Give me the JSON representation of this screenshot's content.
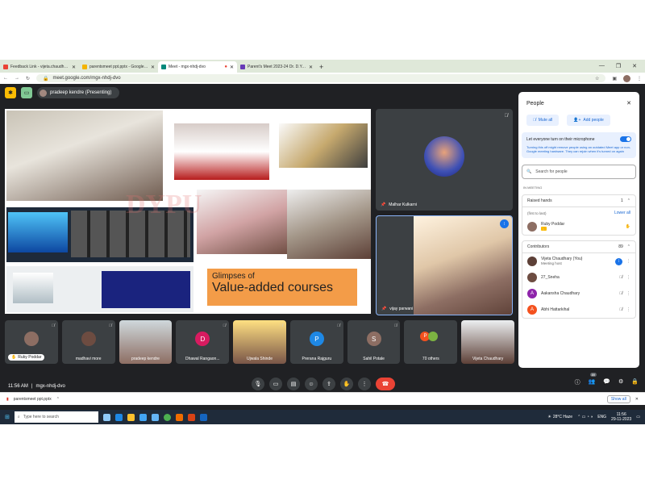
{
  "browser": {
    "tabs": [
      {
        "label": "Feedback Link - vijeta.chaudhar...",
        "color": "#ea4335"
      },
      {
        "label": "parentsmeet ppt.pptx - Google D...",
        "color": "#f4b400"
      },
      {
        "label": "Meet - mgx-nhdj-dvo",
        "color": "#00897b"
      },
      {
        "label": "Parent's Meet 2023-24 Dr. D.Y. P...",
        "color": "#673ab7"
      }
    ],
    "url": "meet.google.com/mgx-nhdj-dvo"
  },
  "meet": {
    "presenter": "pradeep kendre (Presenting)",
    "slide": {
      "title_line1": "Glimpses of",
      "title_line2": "Value-added courses",
      "watermark": "DYPU"
    },
    "tiles": [
      {
        "name": "Malhar Kulkarni"
      },
      {
        "name": "vijay parwani"
      }
    ],
    "strip": [
      {
        "name": "Ruby Poddar",
        "type": "photo",
        "color": "#8d6e63"
      },
      {
        "name": "madhavi more",
        "type": "photo",
        "color": "#6d4c41"
      },
      {
        "name": "pradeep kendre",
        "type": "photo",
        "color": "#a1887f"
      },
      {
        "name": "Dhawal Rangaon...",
        "type": "letter",
        "letter": "D",
        "color": "#d81b60"
      },
      {
        "name": "Ujwala Shinde",
        "type": "photo",
        "color": "#795548"
      },
      {
        "name": "Prerana Rajguru",
        "type": "letter",
        "letter": "P",
        "color": "#1e88e5"
      },
      {
        "name": "Sahil Potale",
        "type": "letter",
        "letter": "S",
        "color": "#8d6e63"
      },
      {
        "name": "70 others",
        "type": "others",
        "color": "#f4511e"
      },
      {
        "name": "Vijeta Chaudhary",
        "type": "photo",
        "color": "#5d4037"
      }
    ],
    "time": "11:56 AM",
    "code": "mgx-nhdj-dvo",
    "badge_count": "89"
  },
  "people_panel": {
    "title": "People",
    "mute_all": "Mute all",
    "add_people": "Add people",
    "toggle_title": "Let everyone turn on their microphone",
    "toggle_desc": "Turning this off might remove people using an outdated Meet app or non-Google meeting hardware. They can rejoin when it's turned on again",
    "search_placeholder": "Search for people",
    "in_meeting": "IN MEETING",
    "raised_hands": {
      "label": "Raised hands",
      "count": "1",
      "order": "(first to last)",
      "lower_all": "Lower all",
      "person": "Ruby Poddar"
    },
    "contributors": {
      "label": "Contributors",
      "count": "89",
      "people": [
        {
          "name": "Vijeta Chaudhary (You)",
          "sub": "Meeting host",
          "color": "#5d4037",
          "letter": ""
        },
        {
          "name": "27_Sneha",
          "sub": "",
          "color": "#6d4c41",
          "letter": ""
        },
        {
          "name": "Aakansha Chaudhary",
          "sub": "",
          "color": "#8e24aa",
          "letter": "A"
        },
        {
          "name": "Abhi Hattarkihal",
          "sub": "",
          "color": "#f4511e",
          "letter": "A"
        }
      ]
    }
  },
  "downloads": {
    "file": "parentsmeet ppt.pptx",
    "show_all": "Show all"
  },
  "taskbar": {
    "search": "Type here to search",
    "weather": "28°C Haze",
    "lang": "ENG",
    "time": "11:56",
    "date": "29-11-2023"
  }
}
